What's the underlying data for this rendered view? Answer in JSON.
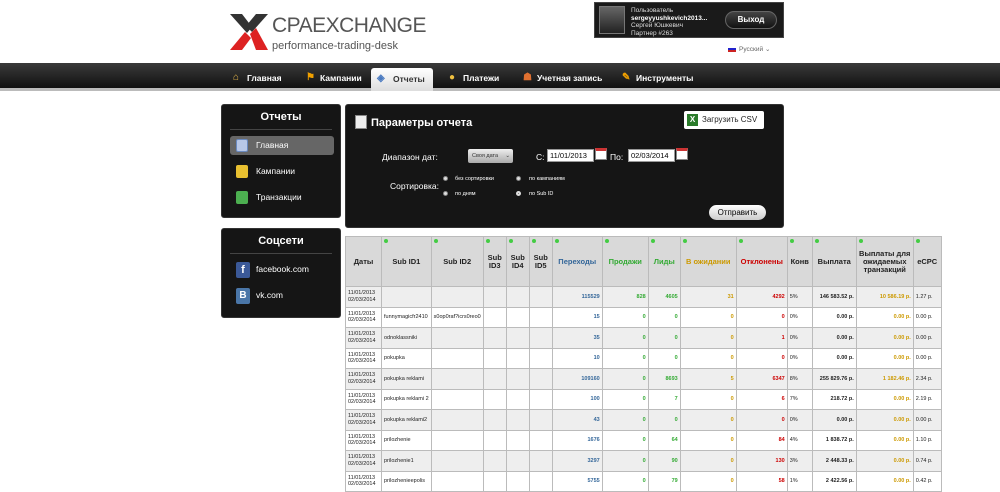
{
  "brand": {
    "name": "CPAEXCHANGE",
    "tagline": "performance-trading-desk"
  },
  "user": {
    "label": "Пользователь",
    "login": "sergeyyushkevich2013...",
    "name": "Сергей Юшкевич",
    "partner": "Партнер #263",
    "logout": "Выход"
  },
  "language": "Русский",
  "nav": [
    {
      "label": "Главная",
      "icon": "home-icon"
    },
    {
      "label": "Кампании",
      "icon": "flag-icon"
    },
    {
      "label": "Отчеты",
      "icon": "reports-icon"
    },
    {
      "label": "Платежи",
      "icon": "coins-icon"
    },
    {
      "label": "Учетная запись",
      "icon": "user-icon"
    },
    {
      "label": "Инструменты",
      "icon": "tools-icon"
    }
  ],
  "reports_panel": {
    "title": "Отчеты",
    "items": [
      {
        "label": "Главная",
        "icon": "report-icon"
      },
      {
        "label": "Кампании",
        "icon": "folder-icon"
      },
      {
        "label": "Транзакции",
        "icon": "transactions-icon"
      }
    ]
  },
  "social_panel": {
    "title": "Соцсети",
    "items": [
      {
        "label": "facebook.com",
        "icon": "facebook-icon"
      },
      {
        "label": "vk.com",
        "icon": "vk-icon"
      }
    ]
  },
  "params": {
    "title": "Параметры отчета",
    "csv": "Загрузить CSV",
    "range_label": "Диапазон дат:",
    "range_value": "Своя дата",
    "from_label": "С:",
    "from_value": "11/01/2013",
    "to_label": "По:",
    "to_value": "02/03/2014",
    "sort_label": "Сортировка:",
    "sort_options": [
      "без сортировки",
      "по кампаниям",
      "по дням",
      "по Sub ID"
    ],
    "submit": "Отправить"
  },
  "colors": {
    "blue": "#336699",
    "green": "#33aa33",
    "gold": "#cc9900",
    "red": "#cc0000"
  },
  "table": {
    "headers": [
      "Даты",
      "Sub ID1",
      "Sub ID2",
      "Sub ID3",
      "Sub ID4",
      "Sub ID5",
      "Переходы",
      "Продажи",
      "Лиды",
      "В ожидании",
      "Отклонены",
      "Конв",
      "Выплата",
      "Выплаты для ожидаемых транзакций",
      "eCPC"
    ],
    "rows": [
      {
        "date1": "11/01/2013",
        "date2": "02/03/2014",
        "sub1": "",
        "sub2": "",
        "clicks": "115529",
        "sales": "828",
        "leads": "4605",
        "pending": "31",
        "rejected": "4292",
        "conv": "5%",
        "payout": "146 583.52 р.",
        "pending_payout": "10 586.19 р.",
        "ecpc": "1.27 р."
      },
      {
        "date1": "11/01/2013",
        "date2": "02/03/2014",
        "sub1": "funnymagicfr2410",
        "sub2": "s0op0raf?icrs0reo0",
        "clicks": "15",
        "sales": "0",
        "leads": "0",
        "pending": "0",
        "rejected": "0",
        "conv": "0%",
        "payout": "0.00 р.",
        "pending_payout": "0.00 р.",
        "ecpc": "0.00 р."
      },
      {
        "date1": "11/01/2013",
        "date2": "02/03/2014",
        "sub1": "odnoklassniki",
        "sub2": "",
        "clicks": "35",
        "sales": "0",
        "leads": "0",
        "pending": "0",
        "rejected": "1",
        "conv": "0%",
        "payout": "0.00 р.",
        "pending_payout": "0.00 р.",
        "ecpc": "0.00 р."
      },
      {
        "date1": "11/01/2013",
        "date2": "02/03/2014",
        "sub1": "pokupka",
        "sub2": "",
        "clicks": "10",
        "sales": "0",
        "leads": "0",
        "pending": "0",
        "rejected": "0",
        "conv": "0%",
        "payout": "0.00 р.",
        "pending_payout": "0.00 р.",
        "ecpc": "0.00 р."
      },
      {
        "date1": "11/01/2013",
        "date2": "02/03/2014",
        "sub1": "pokupka reklami",
        "sub2": "",
        "clicks": "109160",
        "sales": "0",
        "leads": "8693",
        "pending": "5",
        "rejected": "6347",
        "conv": "8%",
        "payout": "255 829.76 р.",
        "pending_payout": "1 182.46 р.",
        "ecpc": "2.34 р."
      },
      {
        "date1": "11/01/2013",
        "date2": "02/03/2014",
        "sub1": "pokupka reklami 2",
        "sub2": "",
        "clicks": "100",
        "sales": "0",
        "leads": "7",
        "pending": "0",
        "rejected": "6",
        "conv": "7%",
        "payout": "218.72 р.",
        "pending_payout": "0.00 р.",
        "ecpc": "2.19 р."
      },
      {
        "date1": "11/01/2013",
        "date2": "02/03/2014",
        "sub1": "pokupka reklami2",
        "sub2": "",
        "clicks": "43",
        "sales": "0",
        "leads": "0",
        "pending": "0",
        "rejected": "0",
        "conv": "0%",
        "payout": "0.00 р.",
        "pending_payout": "0.00 р.",
        "ecpc": "0.00 р."
      },
      {
        "date1": "11/01/2013",
        "date2": "02/03/2014",
        "sub1": "prilozhenie",
        "sub2": "",
        "clicks": "1676",
        "sales": "0",
        "leads": "64",
        "pending": "0",
        "rejected": "84",
        "conv": "4%",
        "payout": "1 838.72 р.",
        "pending_payout": "0.00 р.",
        "ecpc": "1.10 р."
      },
      {
        "date1": "11/01/2013",
        "date2": "02/03/2014",
        "sub1": "prilozhenie1",
        "sub2": "",
        "clicks": "3297",
        "sales": "0",
        "leads": "90",
        "pending": "0",
        "rejected": "130",
        "conv": "3%",
        "payout": "2 448.33 р.",
        "pending_payout": "0.00 р.",
        "ecpc": "0.74 р."
      },
      {
        "date1": "11/01/2013",
        "date2": "02/03/2014",
        "sub1": "prilozhenieepolis",
        "sub2": "",
        "clicks": "5755",
        "sales": "0",
        "leads": "79",
        "pending": "0",
        "rejected": "58",
        "conv": "1%",
        "payout": "2 422.56 р.",
        "pending_payout": "0.00 р.",
        "ecpc": "0.42 р."
      }
    ]
  }
}
